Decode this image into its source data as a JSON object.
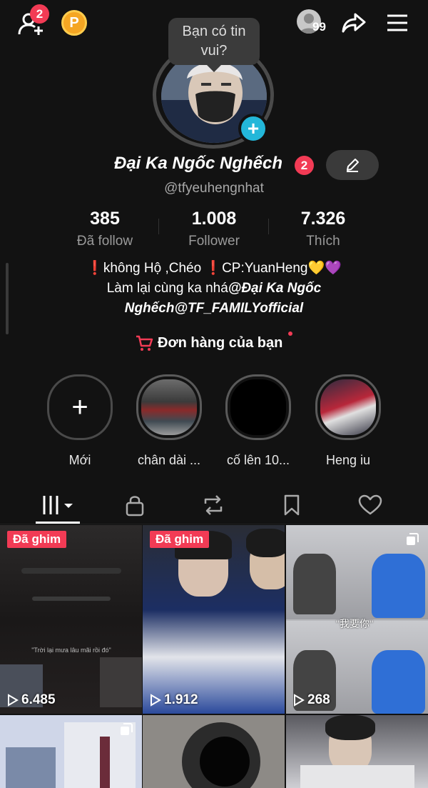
{
  "topbar": {
    "friend_badge_count": "2",
    "coin_label": "P",
    "story_count": "99"
  },
  "profile": {
    "tooltip": "Bạn có tin vui?",
    "name": "Đại Ka Ngốc Nghếch",
    "name_badge": "2",
    "handle": "@tfyeuhengnhat"
  },
  "stats": [
    {
      "value": "385",
      "label": "Đã follow"
    },
    {
      "value": "1.008",
      "label": "Follower"
    },
    {
      "value": "7.326",
      "label": "Thích"
    }
  ],
  "bio": {
    "line1": "❗không Hộ ,Chéo ❗CP:YuanHeng💛💜",
    "line2_prefix": "Làm lại cùng ka nhá",
    "line2_mention": "@Đại Ka Ngốc",
    "line3_mention": "Nghếch@TF_FAMILYofficial"
  },
  "shop": {
    "label": "Đơn hàng của bạn"
  },
  "highlights": [
    {
      "label": "Mới"
    },
    {
      "label": "chân dài ..."
    },
    {
      "label": "cố lên 10..."
    },
    {
      "label": "Heng iu"
    }
  ],
  "tabs": [
    "videos",
    "private",
    "reposts",
    "saved",
    "liked"
  ],
  "videos": [
    {
      "pinned": "Đã ghim",
      "views": "6.485",
      "caption": "\"Trời lại mưa lâu mãi rồi đó\""
    },
    {
      "pinned": "Đã ghim",
      "views": "1.912"
    },
    {
      "views": "268",
      "caption": "\"我要你\""
    },
    {
      "views": ""
    },
    {
      "views": ""
    },
    {
      "views": ""
    }
  ],
  "colors": {
    "background": "#121212",
    "accent": "#f23b55",
    "avatar_add": "#23b7d9",
    "muted_text": "#9a9a9a"
  }
}
